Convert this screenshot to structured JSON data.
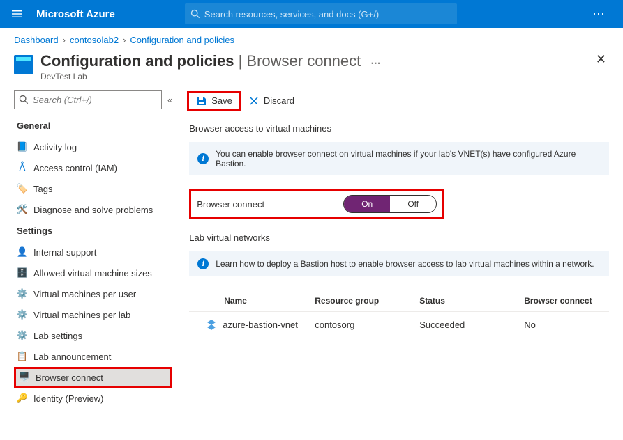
{
  "brand": "Microsoft Azure",
  "search_placeholder": "Search resources, services, and docs (G+/)",
  "breadcrumbs": [
    "Dashboard",
    "contosolab2",
    "Configuration and policies"
  ],
  "page": {
    "title": "Configuration and policies",
    "section": "Browser connect",
    "subtitle": "DevTest Lab"
  },
  "sidebar": {
    "search_placeholder": "Search (Ctrl+/)",
    "sections": {
      "general": {
        "title": "General",
        "items": [
          "Activity log",
          "Access control (IAM)",
          "Tags",
          "Diagnose and solve problems"
        ]
      },
      "settings": {
        "title": "Settings",
        "items": [
          "Internal support",
          "Allowed virtual machine sizes",
          "Virtual machines per user",
          "Virtual machines per lab",
          "Lab settings",
          "Lab announcement",
          "Browser connect",
          "Identity (Preview)"
        ]
      }
    }
  },
  "commands": {
    "save": "Save",
    "discard": "Discard"
  },
  "main": {
    "browser_access_heading": "Browser access to virtual machines",
    "info1": "You can enable browser connect on virtual machines if your lab's VNET(s) have configured Azure Bastion.",
    "toggle_label": "Browser connect",
    "toggle_on": "On",
    "toggle_off": "Off",
    "networks_heading": "Lab virtual networks",
    "info2": "Learn how to deploy a Bastion host to enable browser access to lab virtual machines within a network.",
    "table": {
      "columns": [
        "Name",
        "Resource group",
        "Status",
        "Browser connect"
      ],
      "rows": [
        {
          "name": "azure-bastion-vnet",
          "rg": "contosorg",
          "status": "Succeeded",
          "bc": "No"
        }
      ]
    }
  }
}
